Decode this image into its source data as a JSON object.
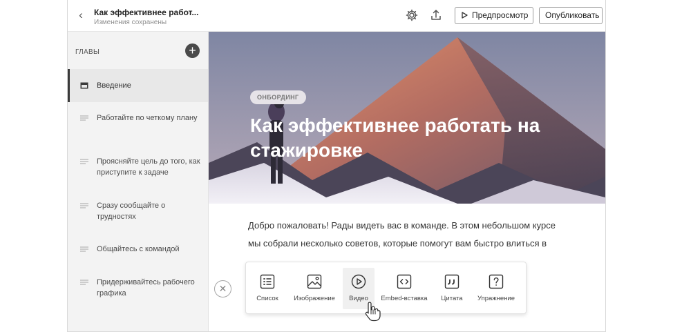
{
  "header": {
    "title": "Как эффективнее работ...",
    "subtitle": "Изменения сохранены",
    "preview_label": "Предпросмотр",
    "publish_label": "Опубликовать"
  },
  "sidebar": {
    "section_label": "ГЛАВЫ",
    "add_symbol": "+",
    "items": [
      {
        "label": "Введение",
        "active": true
      },
      {
        "label": "Работайте по четкому плану"
      },
      {
        "label": "Проясняйте цель до того, как приступите к задаче"
      },
      {
        "label": "Сразу сообщайте о трудностях"
      },
      {
        "label": "Общайтесь с командой"
      },
      {
        "label": "Придерживайтесь рабочего графика"
      }
    ]
  },
  "hero": {
    "badge": "ОНБОРДИНГ",
    "title": "Как эффективнее работать на стажировке"
  },
  "content": {
    "paragraph": "Добро пожаловать! Рады видеть вас в команде. В этом небольшом курсе мы собрали несколько советов, которые помогут вам быстро влиться в"
  },
  "toolbar": {
    "close_symbol": "✕",
    "tools": [
      {
        "label": "Список",
        "icon": "list-icon"
      },
      {
        "label": "Изображение",
        "icon": "image-icon"
      },
      {
        "label": "Видео",
        "icon": "play-icon",
        "hovered": true
      },
      {
        "label": "Embed-вставка",
        "icon": "code-icon"
      },
      {
        "label": "Цитата",
        "icon": "quote-icon"
      },
      {
        "label": "Упражнение",
        "icon": "question-icon"
      }
    ]
  },
  "colors": {
    "accent_dark": "#4a4a4a",
    "sidebar_bg": "#f3f3f3",
    "hero_text": "#ffffff"
  }
}
